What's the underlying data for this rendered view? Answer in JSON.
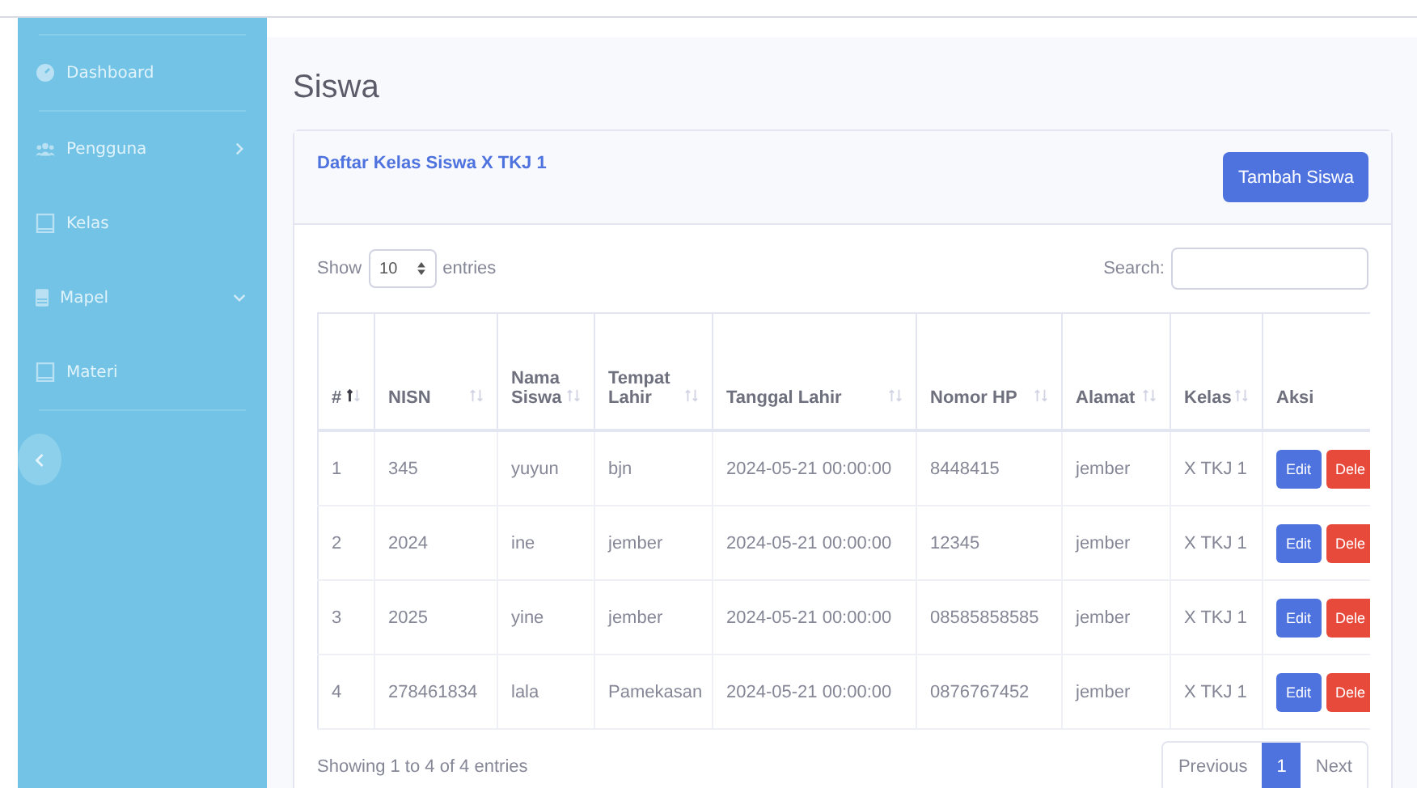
{
  "sidebar": {
    "items": [
      {
        "label": "Dashboard",
        "kind": "link"
      },
      {
        "label": "Pengguna",
        "kind": "menu",
        "expanded": false
      },
      {
        "label": "Kelas",
        "kind": "link"
      },
      {
        "label": "Mapel",
        "kind": "menu",
        "expanded": true
      },
      {
        "label": "Materi",
        "kind": "link"
      }
    ]
  },
  "page_title": "Siswa",
  "card": {
    "title": "Daftar Kelas Siswa X TKJ 1",
    "add_button": "Tambah Siswa",
    "length": {
      "show": "Show",
      "value": "10",
      "entries": "entries"
    },
    "search": {
      "label": "Search:"
    },
    "table": {
      "columns": [
        {
          "label": "#",
          "kind": "sortable",
          "sorted": true
        },
        {
          "label": "NISN",
          "kind": "sortable",
          "sorted": false
        },
        {
          "label": "Nama Siswa",
          "kind": "sortable",
          "sorted": false
        },
        {
          "label": "Tempat Lahir",
          "kind": "sortable",
          "sorted": false
        },
        {
          "label": "Tanggal Lahir",
          "kind": "sortable",
          "sorted": false
        },
        {
          "label": "Nomor HP",
          "kind": "sortable",
          "sorted": false
        },
        {
          "label": "Alamat",
          "kind": "sortable",
          "sorted": false
        },
        {
          "label": "Kelas",
          "kind": "sortable",
          "sorted": false
        },
        {
          "label": "Aksi",
          "kind": "plain"
        }
      ],
      "rows": [
        {
          "cells": [
            "1",
            "345",
            "yuyun",
            "bjn",
            "2024-05-21 00:00:00",
            "8448415",
            "jember",
            "X TKJ 1"
          ],
          "edit": "Edit",
          "delete": "Dele"
        },
        {
          "cells": [
            "2",
            "2024",
            "ine",
            "jember",
            "2024-05-21 00:00:00",
            "12345",
            "jember",
            "X TKJ 1"
          ],
          "edit": "Edit",
          "delete": "Dele"
        },
        {
          "cells": [
            "3",
            "2025",
            "yine",
            "jember",
            "2024-05-21 00:00:00",
            "08585858585",
            "jember",
            "X TKJ 1"
          ],
          "edit": "Edit",
          "delete": "Dele"
        },
        {
          "cells": [
            "4",
            "278461834",
            "lala",
            "Pamekasan",
            "2024-05-21 00:00:00",
            "0876767452",
            "jember",
            "X TKJ 1"
          ],
          "edit": "Edit",
          "delete": "Dele"
        }
      ]
    },
    "info": "Showing 1 to 4 of 4 entries",
    "pagination": [
      {
        "label": "Previous",
        "selected": false
      },
      {
        "label": "1",
        "selected": true
      },
      {
        "label": "Next",
        "selected": false
      }
    ]
  }
}
